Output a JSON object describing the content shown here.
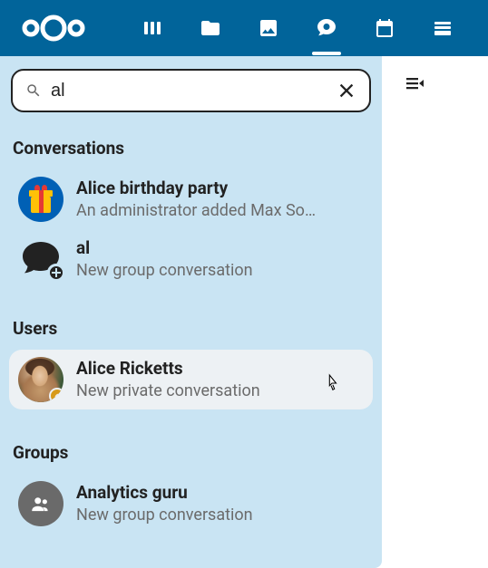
{
  "colors": {
    "brand": "#01649a",
    "sidebar_bg": "#c9e4f3",
    "hover_bg": "#edf1f4"
  },
  "topbar": {
    "nav": [
      {
        "name": "dashboard-icon"
      },
      {
        "name": "files-icon"
      },
      {
        "name": "photos-icon"
      },
      {
        "name": "talk-icon",
        "active": true
      },
      {
        "name": "calendar-icon"
      },
      {
        "name": "deck-icon"
      }
    ]
  },
  "search": {
    "value": "al",
    "placeholder": "Search"
  },
  "sections": {
    "conversations": {
      "title": "Conversations",
      "items": [
        {
          "title": "Alice birthday party",
          "subtitle": "An administrator added Max So…",
          "avatar": "gift"
        },
        {
          "title": "al",
          "subtitle": "New group conversation",
          "avatar": "chat"
        }
      ]
    },
    "users": {
      "title": "Users",
      "items": [
        {
          "title": "Alice Ricketts",
          "subtitle": "New private conversation",
          "avatar": "photo",
          "status": "away",
          "hovered": true
        }
      ]
    },
    "groups": {
      "title": "Groups",
      "items": [
        {
          "title": "Analytics guru",
          "subtitle": "New group conversation",
          "avatar": "group"
        }
      ]
    }
  }
}
